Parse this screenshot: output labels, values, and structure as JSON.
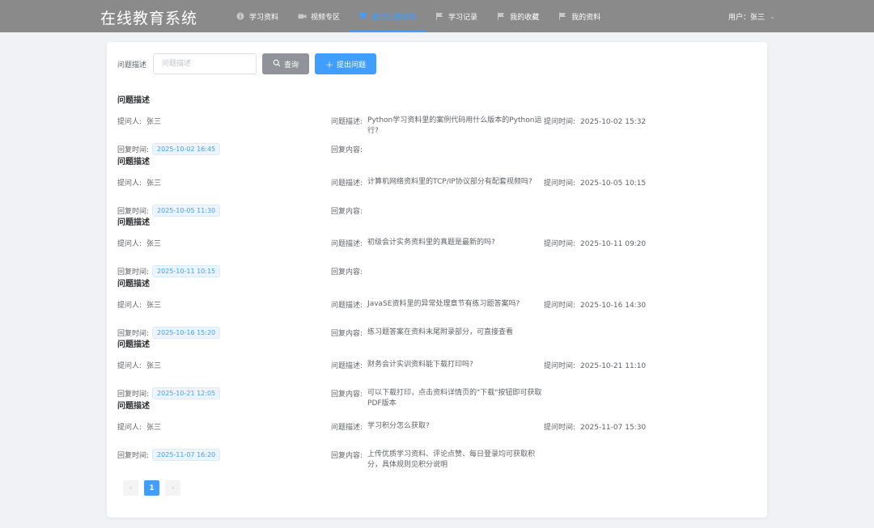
{
  "app": {
    "title": "在线教育系统"
  },
  "nav": [
    {
      "label": "学习资料",
      "icon": "info-circle-icon",
      "active": false
    },
    {
      "label": "视频专区",
      "icon": "video-camera-icon",
      "active": false
    },
    {
      "label": "教学问题求助",
      "icon": "flag-icon",
      "active": true
    },
    {
      "label": "学习记录",
      "icon": "flag-icon",
      "active": false
    },
    {
      "label": "我的收藏",
      "icon": "flag-icon",
      "active": false
    },
    {
      "label": "我的资料",
      "icon": "flag-icon",
      "active": false
    }
  ],
  "user": {
    "label": "用户：张三"
  },
  "search": {
    "label": "问题描述",
    "value": "",
    "placeholder": "问题描述",
    "query_label": "查询",
    "add_label": "提出问题"
  },
  "labels": {
    "asker": "提问人:",
    "desc": "问题描述:",
    "ask_time": "提问时间:",
    "reply_time": "回复时间:",
    "reply_content": "回复内容:"
  },
  "questions": [
    {
      "title": "问题描述",
      "asker": "张三",
      "desc": "Python学习资料里的案例代码用什么版本的Python运行?",
      "ask_time": "2025-10-02 15:32",
      "reply_time": "2025-10-02 16:45",
      "reply": ""
    },
    {
      "title": "问题描述",
      "asker": "张三",
      "desc": "计算机网络资料里的TCP/IP协议部分有配套视频吗?",
      "ask_time": "2025-10-05 10:15",
      "reply_time": "2025-10-05 11:30",
      "reply": ""
    },
    {
      "title": "问题描述",
      "asker": "张三",
      "desc": "初级会计实务资料里的真题是最新的吗?",
      "ask_time": "2025-10-11 09:20",
      "reply_time": "2025-10-11 10:15",
      "reply": ""
    },
    {
      "title": "问题描述",
      "asker": "张三",
      "desc": "JavaSE资料里的异常处理章节有练习题答案吗?",
      "ask_time": "2025-10-16 14:30",
      "reply_time": "2025-10-16 15:20",
      "reply": "练习题答案在资料末尾附录部分，可直接查看"
    },
    {
      "title": "问题描述",
      "asker": "张三",
      "desc": "财务会计实训资料能下载打印吗?",
      "ask_time": "2025-10-21 11:10",
      "reply_time": "2025-10-21 12:05",
      "reply": "可以下载打印，点击资料详情页的\"下载\"按钮即可获取PDF版本"
    },
    {
      "title": "问题描述",
      "asker": "张三",
      "desc": "学习积分怎么获取?",
      "ask_time": "2025-11-07 15:30",
      "reply_time": "2025-11-07 16:20",
      "reply": "上传优质学习资料、评论点赞、每日登录均可获取积分，具体规则见积分说明"
    }
  ],
  "pagination": {
    "prev": "‹",
    "current": "1",
    "next": "›"
  },
  "colors": {
    "primary": "#409eff",
    "topbar": "#8a8a8a",
    "query_button": "#909399"
  }
}
